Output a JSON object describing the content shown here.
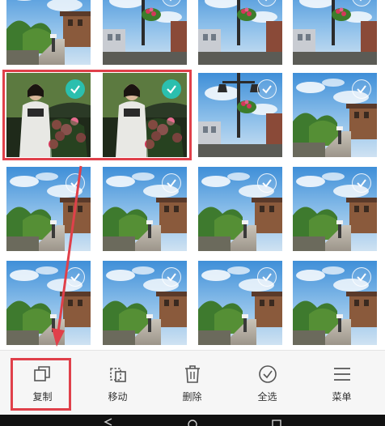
{
  "toolbar": {
    "copy_label": "复制",
    "move_label": "移动",
    "delete_label": "删除",
    "select_all_label": "全选",
    "menu_label": "菜单"
  },
  "icons": {
    "copy": "copy-icon",
    "move": "move-icon",
    "delete": "trash-icon",
    "select_all": "check-circle-icon",
    "menu": "menu-icon",
    "selected": "checkmark-icon"
  },
  "selection": {
    "selected_tiles": [
      0,
      1
    ]
  },
  "colors": {
    "accent": "#2bbfae",
    "highlight": "#e0404a"
  }
}
